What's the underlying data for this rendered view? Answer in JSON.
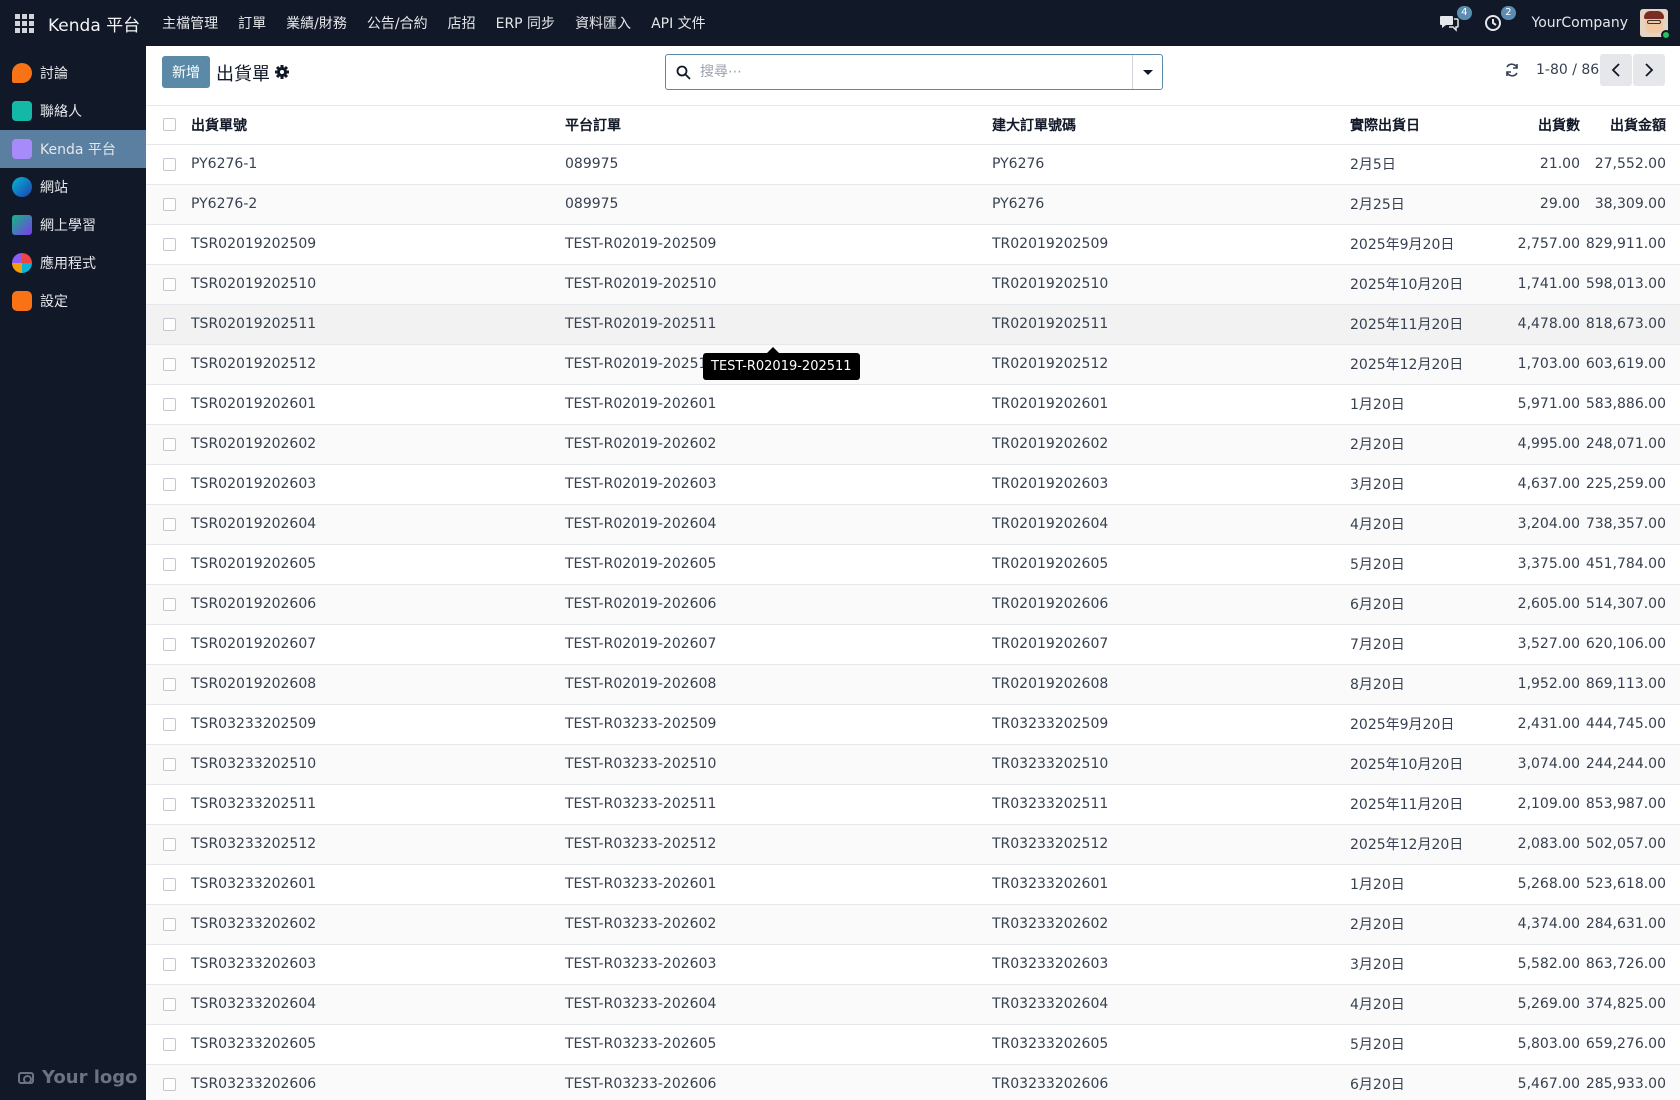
{
  "navbar": {
    "brand": "Kenda 平台",
    "menu": [
      "主檔管理",
      "訂單",
      "業績/財務",
      "公告/合約",
      "店招",
      "ERP 同步",
      "資料匯入",
      "API 文件"
    ],
    "messages_count": "4",
    "activities_count": "2",
    "company": "YourCompany"
  },
  "sidebar": {
    "items": [
      {
        "label": "討論",
        "icon": "discuss-icon",
        "color": "#f97316"
      },
      {
        "label": "聯絡人",
        "icon": "contacts-icon",
        "color": "#14b8a6"
      },
      {
        "label": "Kenda 平台",
        "icon": "kenda-platform-icon",
        "color": "#a78bfa"
      },
      {
        "label": "網站",
        "icon": "website-icon",
        "color": "#06b6d4"
      },
      {
        "label": "網上學習",
        "icon": "elearning-icon",
        "color": "#10b981"
      },
      {
        "label": "應用程式",
        "icon": "apps-icon",
        "color": "#ef4444"
      },
      {
        "label": "設定",
        "icon": "settings-icon",
        "color": "#f97316"
      }
    ],
    "logo": "Your logo"
  },
  "control_panel": {
    "new_label": "新增",
    "title": "出貨單",
    "search_placeholder": "搜尋⋯",
    "pager": "1-80 / 86"
  },
  "table": {
    "columns": [
      "出貨單號",
      "平台訂單",
      "建大訂單號碼",
      "實際出貨日",
      "出貨數",
      "出貨金額"
    ],
    "rows": [
      [
        "PY6276-1",
        "089975",
        "PY6276",
        "2月5日",
        "21.00",
        "27,552.00"
      ],
      [
        "PY6276-2",
        "089975",
        "PY6276",
        "2月25日",
        "29.00",
        "38,309.00"
      ],
      [
        "TSR02019202509",
        "TEST-R02019-202509",
        "TR02019202509",
        "2025年9月20日",
        "2,757.00",
        "829,911.00"
      ],
      [
        "TSR02019202510",
        "TEST-R02019-202510",
        "TR02019202510",
        "2025年10月20日",
        "1,741.00",
        "598,013.00"
      ],
      [
        "TSR02019202511",
        "TEST-R02019-202511",
        "TR02019202511",
        "2025年11月20日",
        "4,478.00",
        "818,673.00"
      ],
      [
        "TSR02019202512",
        "TEST-R02019-202512",
        "TR02019202512",
        "2025年12月20日",
        "1,703.00",
        "603,619.00"
      ],
      [
        "TSR02019202601",
        "TEST-R02019-202601",
        "TR02019202601",
        "1月20日",
        "5,971.00",
        "583,886.00"
      ],
      [
        "TSR02019202602",
        "TEST-R02019-202602",
        "TR02019202602",
        "2月20日",
        "4,995.00",
        "248,071.00"
      ],
      [
        "TSR02019202603",
        "TEST-R02019-202603",
        "TR02019202603",
        "3月20日",
        "4,637.00",
        "225,259.00"
      ],
      [
        "TSR02019202604",
        "TEST-R02019-202604",
        "TR02019202604",
        "4月20日",
        "3,204.00",
        "738,357.00"
      ],
      [
        "TSR02019202605",
        "TEST-R02019-202605",
        "TR02019202605",
        "5月20日",
        "3,375.00",
        "451,784.00"
      ],
      [
        "TSR02019202606",
        "TEST-R02019-202606",
        "TR02019202606",
        "6月20日",
        "2,605.00",
        "514,307.00"
      ],
      [
        "TSR02019202607",
        "TEST-R02019-202607",
        "TR02019202607",
        "7月20日",
        "3,527.00",
        "620,106.00"
      ],
      [
        "TSR02019202608",
        "TEST-R02019-202608",
        "TR02019202608",
        "8月20日",
        "1,952.00",
        "869,113.00"
      ],
      [
        "TSR03233202509",
        "TEST-R03233-202509",
        "TR03233202509",
        "2025年9月20日",
        "2,431.00",
        "444,745.00"
      ],
      [
        "TSR03233202510",
        "TEST-R03233-202510",
        "TR03233202510",
        "2025年10月20日",
        "3,074.00",
        "244,244.00"
      ],
      [
        "TSR03233202511",
        "TEST-R03233-202511",
        "TR03233202511",
        "2025年11月20日",
        "2,109.00",
        "853,987.00"
      ],
      [
        "TSR03233202512",
        "TEST-R03233-202512",
        "TR03233202512",
        "2025年12月20日",
        "2,083.00",
        "502,057.00"
      ],
      [
        "TSR03233202601",
        "TEST-R03233-202601",
        "TR03233202601",
        "1月20日",
        "5,268.00",
        "523,618.00"
      ],
      [
        "TSR03233202602",
        "TEST-R03233-202602",
        "TR03233202602",
        "2月20日",
        "4,374.00",
        "284,631.00"
      ],
      [
        "TSR03233202603",
        "TEST-R03233-202603",
        "TR03233202603",
        "3月20日",
        "5,582.00",
        "863,726.00"
      ],
      [
        "TSR03233202604",
        "TEST-R03233-202604",
        "TR03233202604",
        "4月20日",
        "5,269.00",
        "374,825.00"
      ],
      [
        "TSR03233202605",
        "TEST-R03233-202605",
        "TR03233202605",
        "5月20日",
        "5,803.00",
        "659,276.00"
      ],
      [
        "TSR03233202606",
        "TEST-R03233-202606",
        "TR03233202606",
        "6月20日",
        "5,467.00",
        "285,933.00"
      ]
    ],
    "hover_row": 4
  },
  "tooltip": "TEST-R02019-202511"
}
